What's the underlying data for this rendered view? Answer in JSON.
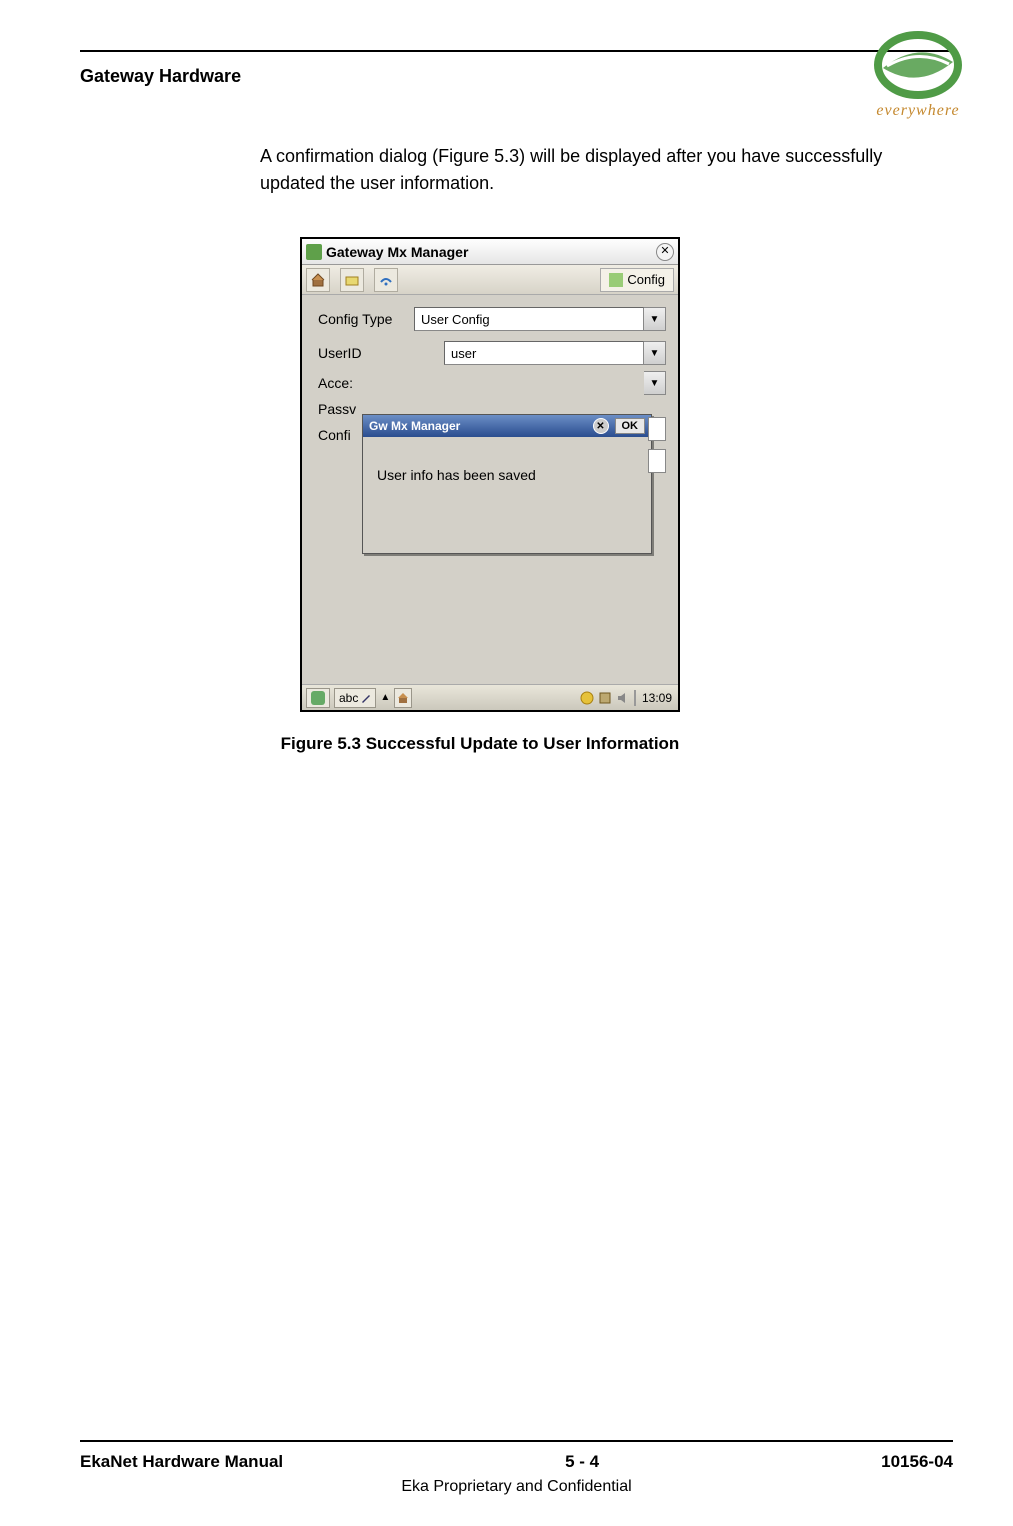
{
  "header": {
    "section_title": "Gateway Hardware",
    "logo_text": "everywhere"
  },
  "body": {
    "paragraph": "A confirmation dialog (Figure 5.3) will be displayed after you have successfully updated the user information."
  },
  "figure": {
    "caption": "Figure 5.3  Successful Update to User Information",
    "app_window": {
      "title": "Gateway Mx Manager",
      "tab_label": "Config",
      "fields": {
        "config_type": {
          "label": "Config Type",
          "value": "User Config"
        },
        "user_id": {
          "label": "UserID",
          "value": "user"
        },
        "access": {
          "label": "Acce:"
        },
        "password": {
          "label": "Passv"
        },
        "confirm": {
          "label": "Confi"
        }
      },
      "dialog": {
        "title": "Gw Mx Manager",
        "ok_label": "OK",
        "message": "User info has been saved"
      },
      "taskbar": {
        "input_mode": "abc",
        "clock": "13:09"
      }
    }
  },
  "footer": {
    "left": "EkaNet Hardware Manual",
    "center": "5 - 4",
    "right": "10156-04",
    "sub": "Eka Proprietary and Confidential"
  }
}
